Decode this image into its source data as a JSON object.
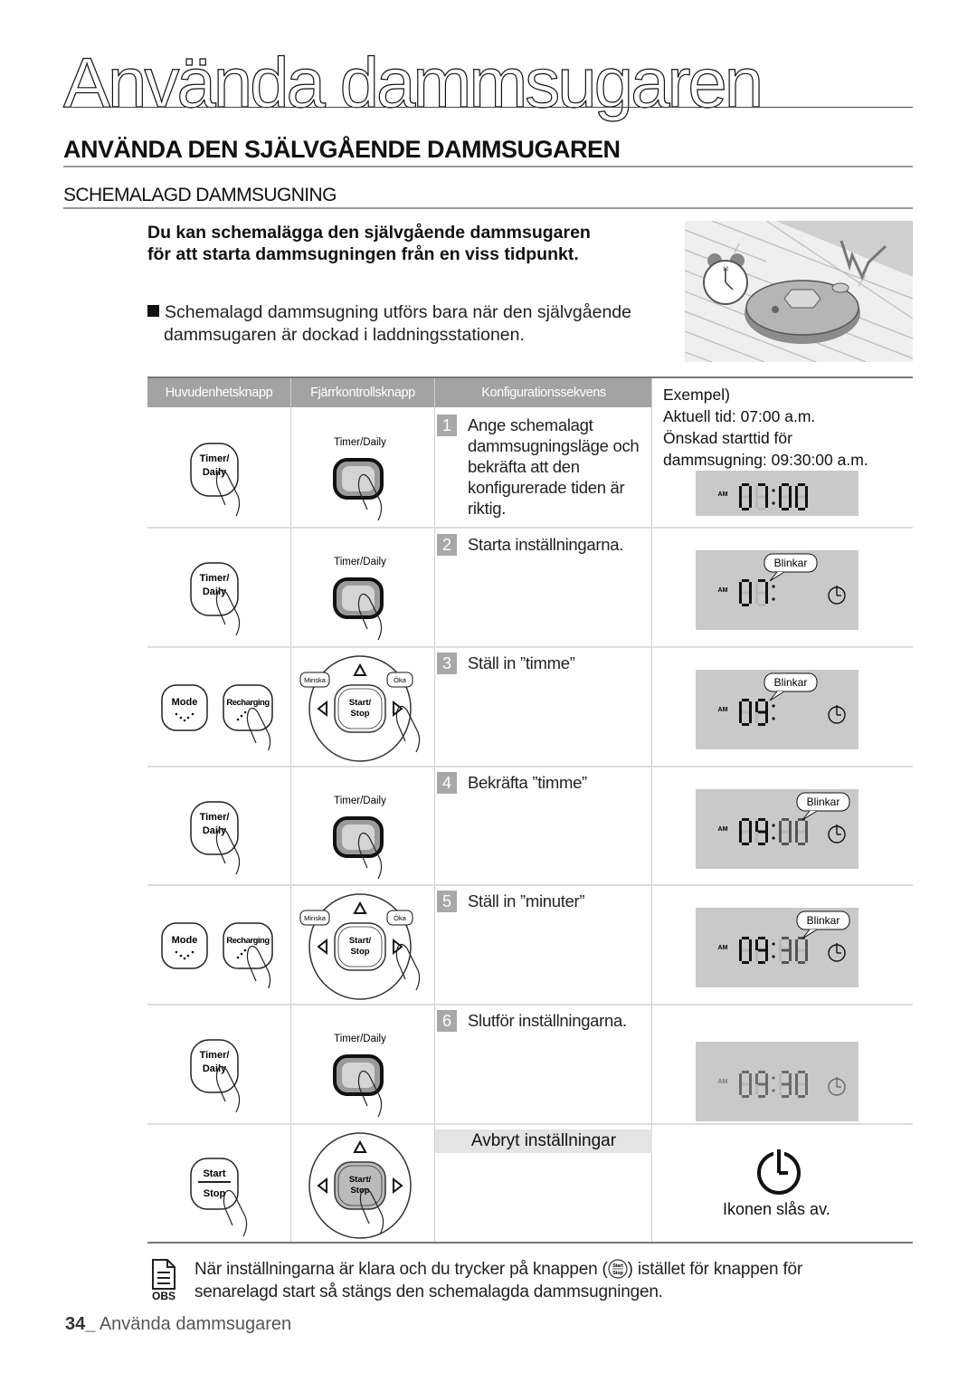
{
  "chapter_title": "Använda dammsugaren",
  "section_title": "ANVÄNDA DEN SJÄLVGÅENDE DAMMSUGAREN",
  "subsection_title": "SCHEMALAGD DAMMSUGNING",
  "intro": {
    "line1": "Du kan schemalägga den självgående dammsugaren",
    "line2": "för att starta dammsugningen från en viss tidpunkt."
  },
  "note": {
    "line1": "Schemalagd dammsugning utförs bara när den självgående",
    "line2": "dammsugaren är dockad i laddningsstationen."
  },
  "illustration": {
    "icons": [
      "alarm-clock",
      "robot-vacuum",
      "signal-zigzag"
    ]
  },
  "table": {
    "headers": [
      "Huvudenhetsknapp",
      "Fjärrkontrollsknapp",
      "Konfigurationssekvens"
    ],
    "example": {
      "title": "Exempel)",
      "current": "Aktuell tid: 07:00 a.m.",
      "desired1": "Önskad starttid för",
      "desired2": "dammsugning: 09:30:00 a.m."
    },
    "blink_label": "Blinkar",
    "am_label": "AM",
    "main_buttons": {
      "timer": [
        "Timer/",
        "Daily"
      ],
      "mode": "Mode",
      "recharging": "Recharging",
      "start": "Start",
      "stop": "Stop"
    },
    "remote_buttons": {
      "timer_daily": "Timer/Daily",
      "decrease": "Minska",
      "increase": "Öka",
      "start_stop": [
        "Start/",
        "Stop"
      ]
    },
    "steps": [
      {
        "num": "1",
        "text": "Ange schemalagt dammsugningsläge och bekräfta att den konfigurerade tiden är riktig.",
        "display": {
          "hours": "07",
          "minutes": "00",
          "blink": false,
          "clock_icon": false
        }
      },
      {
        "num": "2",
        "text": "Starta inställningarna.",
        "display": {
          "hours": "07",
          "minutes": "",
          "blink": true,
          "clock_icon": true
        }
      },
      {
        "num": "3",
        "text": "Ställ in ”timme”",
        "display": {
          "hours": "09",
          "minutes": "",
          "blink": true,
          "clock_icon": true
        }
      },
      {
        "num": "4",
        "text": "Bekräfta ”timme”",
        "display": {
          "hours": "09",
          "minutes": "00",
          "blink": true,
          "clock_icon": true
        }
      },
      {
        "num": "5",
        "text": "Ställ in ”minuter”",
        "display": {
          "hours": "09",
          "minutes": "30",
          "blink": true,
          "clock_icon": true
        }
      },
      {
        "num": "6",
        "text": "Slutför inställningarna.",
        "display": {
          "hours": "09",
          "minutes": "30",
          "blink": false,
          "clock_icon": true
        }
      }
    ],
    "cancel": {
      "label": "Avbryt inställningar",
      "result": "Ikonen slås av."
    }
  },
  "obs": {
    "label": "OBS",
    "line1_a": "När inställningarna är klara och du trycker på knappen (",
    "line1_b": ") istället för knappen för",
    "line2": "senarelagd start så stängs den schemalagda dammsugningen.",
    "inline_button": [
      "Start",
      "Stop"
    ]
  },
  "footer": {
    "page": "34_",
    "title": " Använda dammsugaren"
  }
}
